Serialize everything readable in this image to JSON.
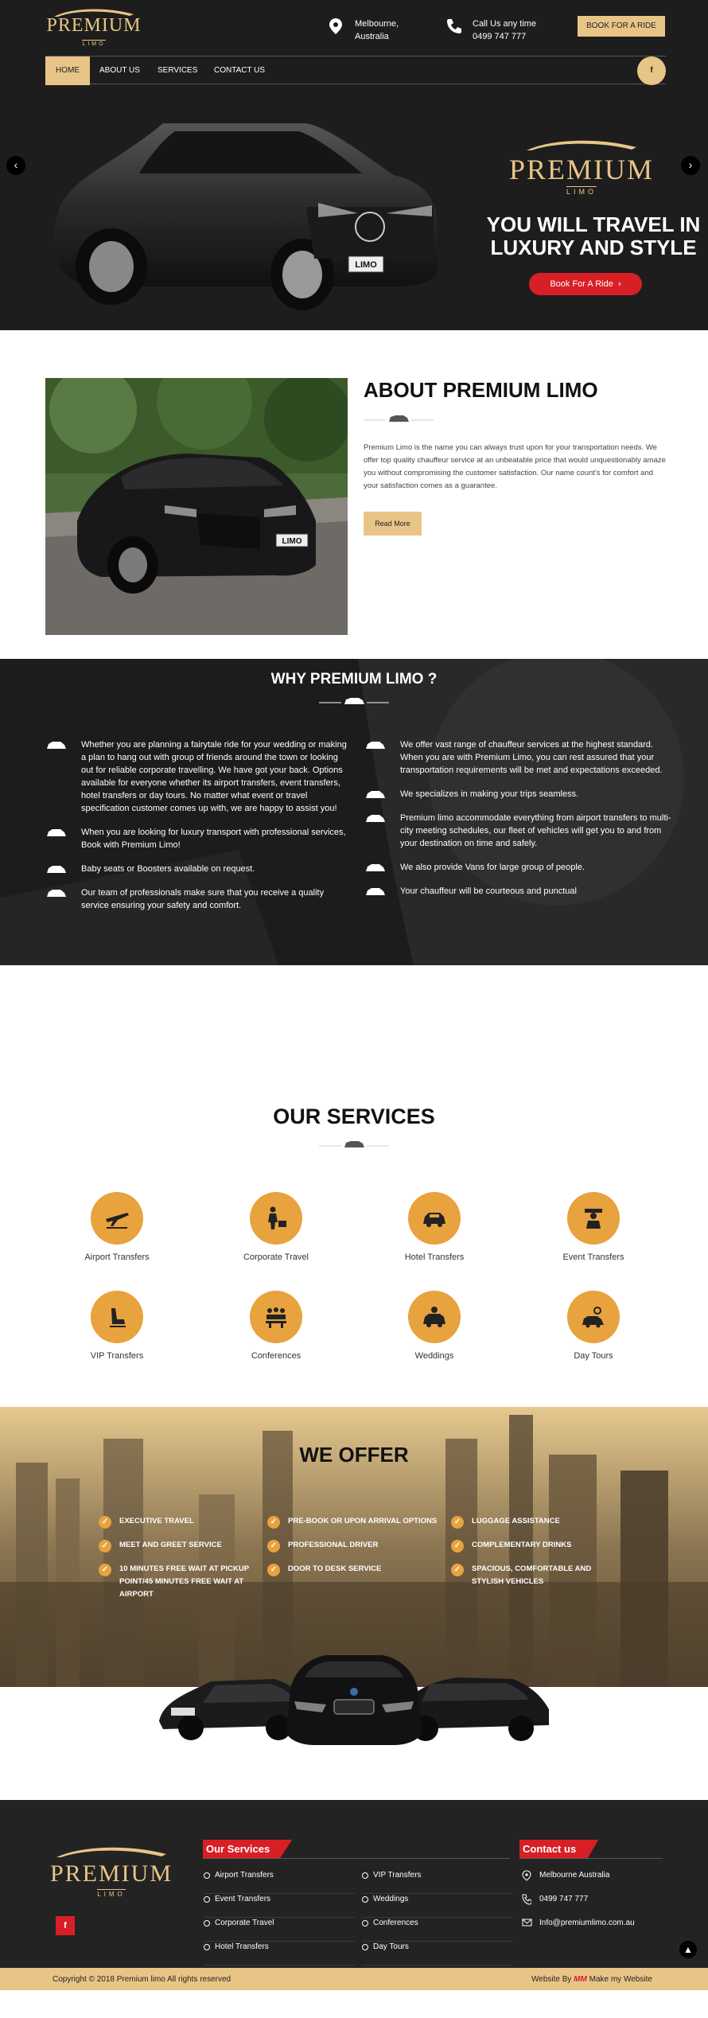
{
  "brand": {
    "name": "PREMIUM",
    "tagline": "LIMO",
    "colors": {
      "gold": "#e8c587",
      "orange": "#e8a23e",
      "red": "#d81f26",
      "dark": "#1e1d1e"
    }
  },
  "header": {
    "location": [
      "Melbourne,",
      "Australia"
    ],
    "call_label": "Call Us any time",
    "phone": "0499 747 777",
    "book_label": "BOOK FOR A RIDE",
    "nav": [
      "HOME",
      "ABOUT US",
      "SERVICES",
      "CONTACT US"
    ],
    "fb_label": "f"
  },
  "hero": {
    "title_line1": "YOU WILL TRAVEL IN",
    "title_line2": "LUXURY AND STYLE",
    "button": "Book For A Ride",
    "plate": "LIMO"
  },
  "about": {
    "title": "ABOUT PREMIUM LIMO",
    "text": "Premium Limo is the name you can always trust upon for your transportation needs. We offer top quality chauffeur service at an unbeatable price that would unquestionably amaze you without compromising the customer satisfaction. Our name count's for comfort and your satisfaction comes as a guarantee.",
    "button": "Read More",
    "plate": "LIMO"
  },
  "why": {
    "title": "WHY PREMIUM LIMO ?",
    "left": [
      "Whether you are planning a fairytale ride for your wedding or making a plan to hang out with group of friends around the town or looking out for reliable corporate travelling. We have got your back. Options available for everyone whether its airport transfers, event transfers, hotel transfers or day tours. No matter what event or travel specification customer comes up with, we are happy to assist you!",
      "When you are looking for luxury transport with professional services, Book with Premium Limo!",
      "Baby seats or Boosters available on request.",
      "Our team of professionals make sure that you receive a quality service ensuring your safety and comfort."
    ],
    "right": [
      "We offer vast range of chauffeur services at the highest standard. When you are with Premium Limo, you can rest assured that your transportation requirements will be met and expectations exceeded.",
      "We specializes in making your trips seamless.",
      "Premium limo accommodate everything from airport transfers to multi-city meeting schedules, our fleet of vehicles will get you to and from your destination on time and safely.",
      "We also provide Vans for large group of people.",
      "Your chauffeur will be courteous and punctual"
    ]
  },
  "services": {
    "title": "OUR SERVICES",
    "items": [
      {
        "label": "Airport Transfers",
        "icon": "airplane-icon"
      },
      {
        "label": "Corporate Travel",
        "icon": "briefcase-person-icon"
      },
      {
        "label": "Hotel Transfers",
        "icon": "car-icon"
      },
      {
        "label": "Event Transfers",
        "icon": "chauffeur-icon"
      },
      {
        "label": "VIP Transfers",
        "icon": "seat-icon"
      },
      {
        "label": "Conferences",
        "icon": "meeting-icon"
      },
      {
        "label": "Weddings",
        "icon": "wedding-car-icon"
      },
      {
        "label": "Day Tours",
        "icon": "tour-car-icon"
      }
    ]
  },
  "offer": {
    "title": "WE OFFER",
    "col1": [
      "EXECUTIVE TRAVEL",
      "MEET AND GREET SERVICE",
      "10 MINUTES FREE WAIT AT PICKUP POINT/45 MINUTES FREE WAIT AT AIRPORT"
    ],
    "col2": [
      "PRE-BOOK OR UPON ARRIVAL OPTIONS",
      "PROFESSIONAL DRIVER",
      "DOOR TO DESK SERVICE"
    ],
    "col3": [
      "LUGGAGE ASSISTANCE",
      "COMPLEMENTARY DRINKS",
      "SPACIOUS, COMFORTABLE AND STYLISH VEHICLES"
    ]
  },
  "footer": {
    "services_title": "Our Services",
    "services_col1": [
      "Airport Transfers",
      "Event Transfers",
      "Corporate Travel",
      "Hotel Transfers"
    ],
    "services_col2": [
      "VIP Transfers",
      "Weddings",
      "Conferences",
      "Day Tours"
    ],
    "contact_title": "Contact us",
    "address": "Melbourne Australia",
    "phone": "0499 747 777",
    "email": "Info@premiumlimo.com.au",
    "fb_label": "f",
    "copyright": "Copyright © 2018 Premium limo All rights reserved",
    "credit_prefix": "Website By",
    "credit_logo": "MM",
    "credit_suffix": "Make my Website"
  }
}
